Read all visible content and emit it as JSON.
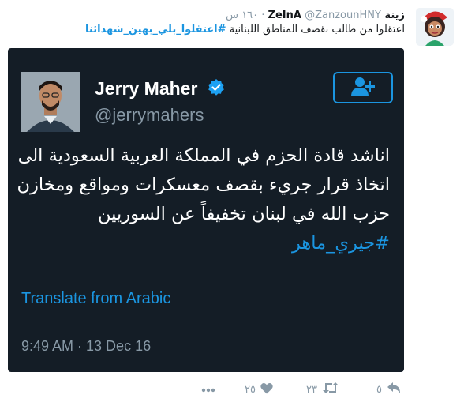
{
  "tweet": {
    "author_name": "زينة ZeInA",
    "author_handle": "@ZanzounHNY",
    "time": "١٦٠ س",
    "text": "اعتقلوا من طالب بقصف المناطق اللبنانية",
    "hashtag": "#اعتقلوا_بلي_بهين_شهدائنا"
  },
  "quoted": {
    "name": "Jerry Maher",
    "handle": "@jerrymahers",
    "body": "اناشد قادة الحزم في المملكة العربية السعودية الى اتخاذ قرار جريء بقصف معسكرات ومواقع ومخازن حزب الله في لبنان تخفيفاً عن السوريين",
    "hashtag": "#جيري_ماهر",
    "translate_label": "Translate from Arabic",
    "timestamp": "9:49 AM · 13 Dec 16"
  },
  "actions": {
    "reply_count": "٥",
    "retweet_count": "٢٣",
    "like_count": "٢٥"
  },
  "icons": {
    "verified": "verified-badge-icon",
    "follow": "add-user-icon",
    "reply": "reply-icon",
    "retweet": "retweet-icon",
    "like": "heart-icon",
    "more": "more-dots-icon"
  },
  "colors": {
    "accent": "#1b95e0",
    "card_background": "#141d26",
    "muted": "#8899a6"
  }
}
